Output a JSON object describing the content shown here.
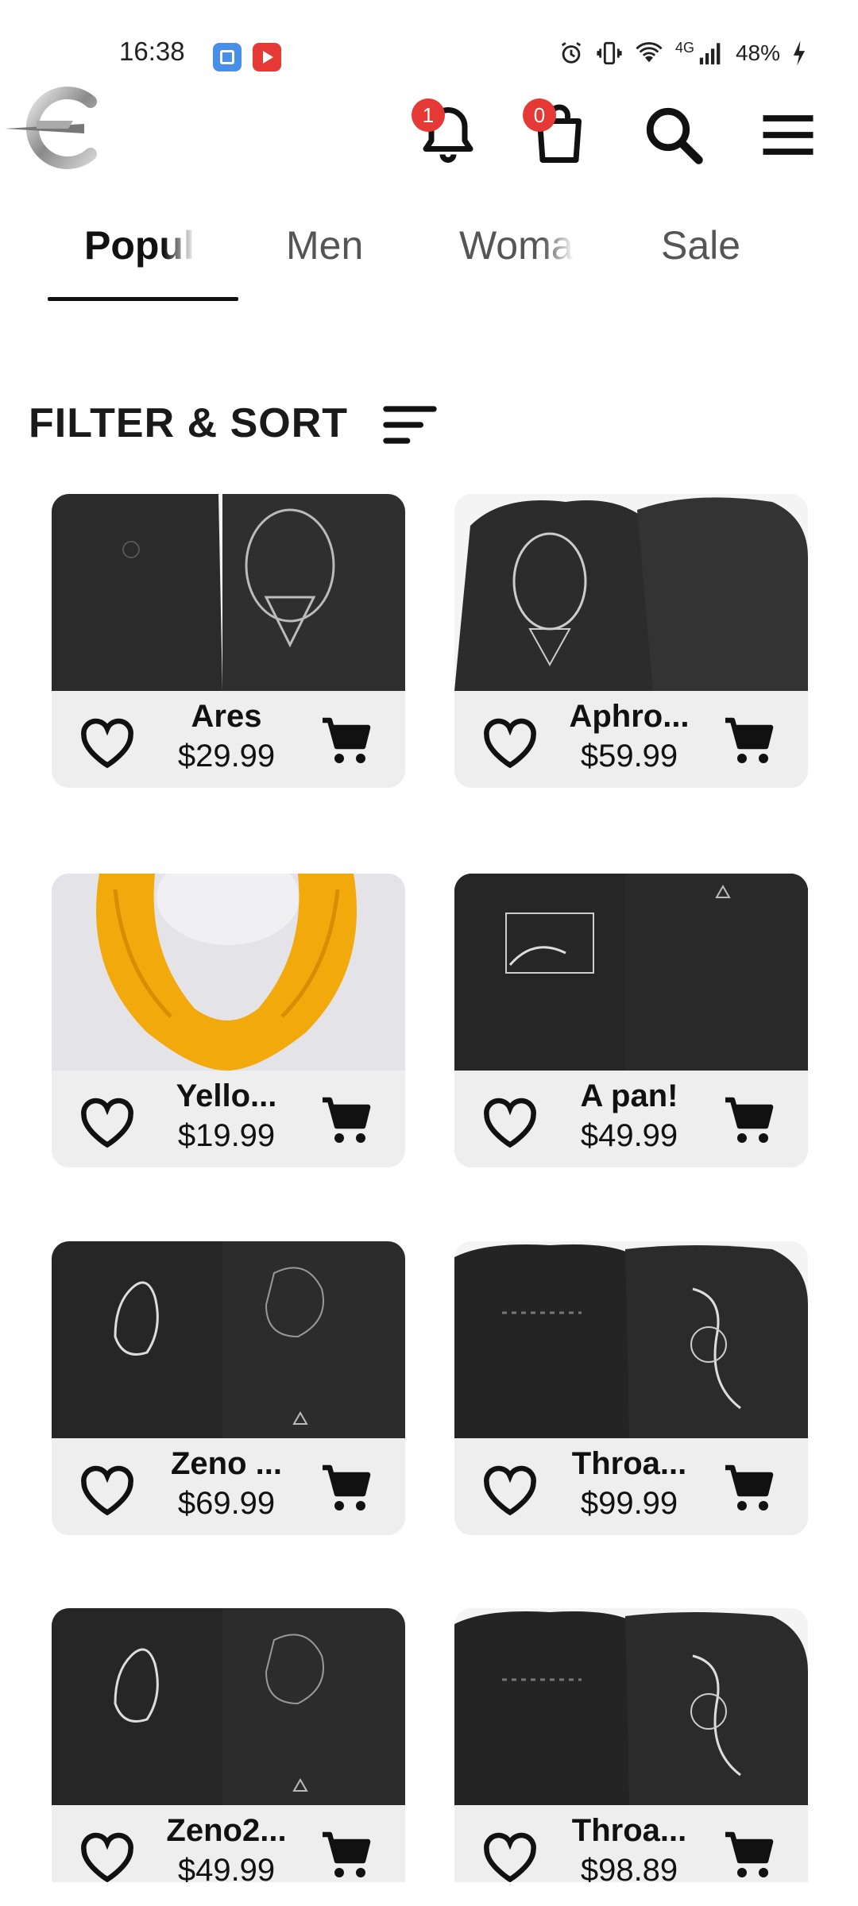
{
  "status_bar": {
    "time": "16:38",
    "network": "4G",
    "battery": "48%",
    "icons": [
      "alarm-icon",
      "vibrate-icon",
      "wifi-icon",
      "signal-icon",
      "battery-charging-icon"
    ]
  },
  "header": {
    "notification_count": "1",
    "cart_count": "0"
  },
  "tabs": [
    {
      "label": "Popul",
      "active": true
    },
    {
      "label": "Men",
      "active": false
    },
    {
      "label": "Woma",
      "active": false
    },
    {
      "label": "Sale",
      "active": false
    }
  ],
  "filter": {
    "label": "FILTER & SORT"
  },
  "products": [
    {
      "name": "Ares",
      "price": "$29.99"
    },
    {
      "name": "Aphro...",
      "price": "$59.99"
    },
    {
      "name": "Yello...",
      "price": "$19.99"
    },
    {
      "name": "A pan!",
      "price": "$49.99"
    },
    {
      "name": "Zeno ...",
      "price": "$69.99"
    },
    {
      "name": "Throa...",
      "price": "$99.99"
    },
    {
      "name": "Zeno2...",
      "price": "$49.99"
    },
    {
      "name": "Throa...",
      "price": "$98.89"
    }
  ],
  "colors": {
    "badge": "#e53935",
    "card_bg": "#eeeeee",
    "accent": "#111111"
  }
}
